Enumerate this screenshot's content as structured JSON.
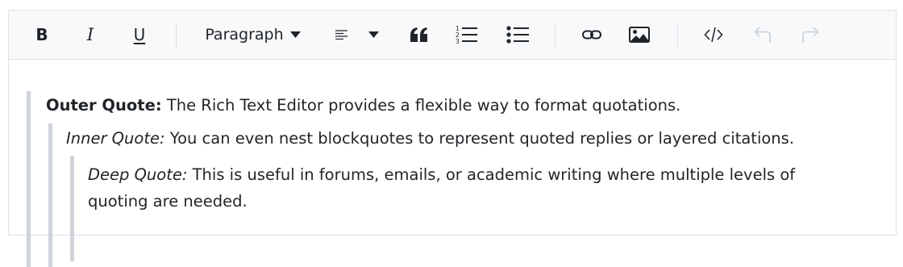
{
  "toolbar": {
    "bold_label": "B",
    "italic_label": "I",
    "underline_label": "U",
    "format_label": "Paragraph",
    "icons": [
      "bold-icon",
      "italic-icon",
      "underline-icon",
      "align-left-icon",
      "blockquote-icon",
      "ordered-list-icon",
      "unordered-list-icon",
      "link-icon",
      "image-icon",
      "code-view-icon",
      "undo-icon",
      "redo-icon"
    ],
    "disabled_color": "#ced4da"
  },
  "content": {
    "outer": {
      "label": "Outer Quote:",
      "text": " The Rich Text Editor provides a flexible way to format quotations."
    },
    "inner": {
      "label": "Inner Quote:",
      "text": " You can even nest blockquotes to represent quoted replies or layered citations."
    },
    "deep": {
      "label": "Deep Quote:",
      "text": " This is useful in forums, emails, or academic writing where multiple levels of quoting are needed."
    }
  },
  "colors": {
    "toolbar_bg": "#f8f9fa",
    "border": "#dee2e6",
    "quote_bar": "#ced4da",
    "text": "#212529"
  }
}
